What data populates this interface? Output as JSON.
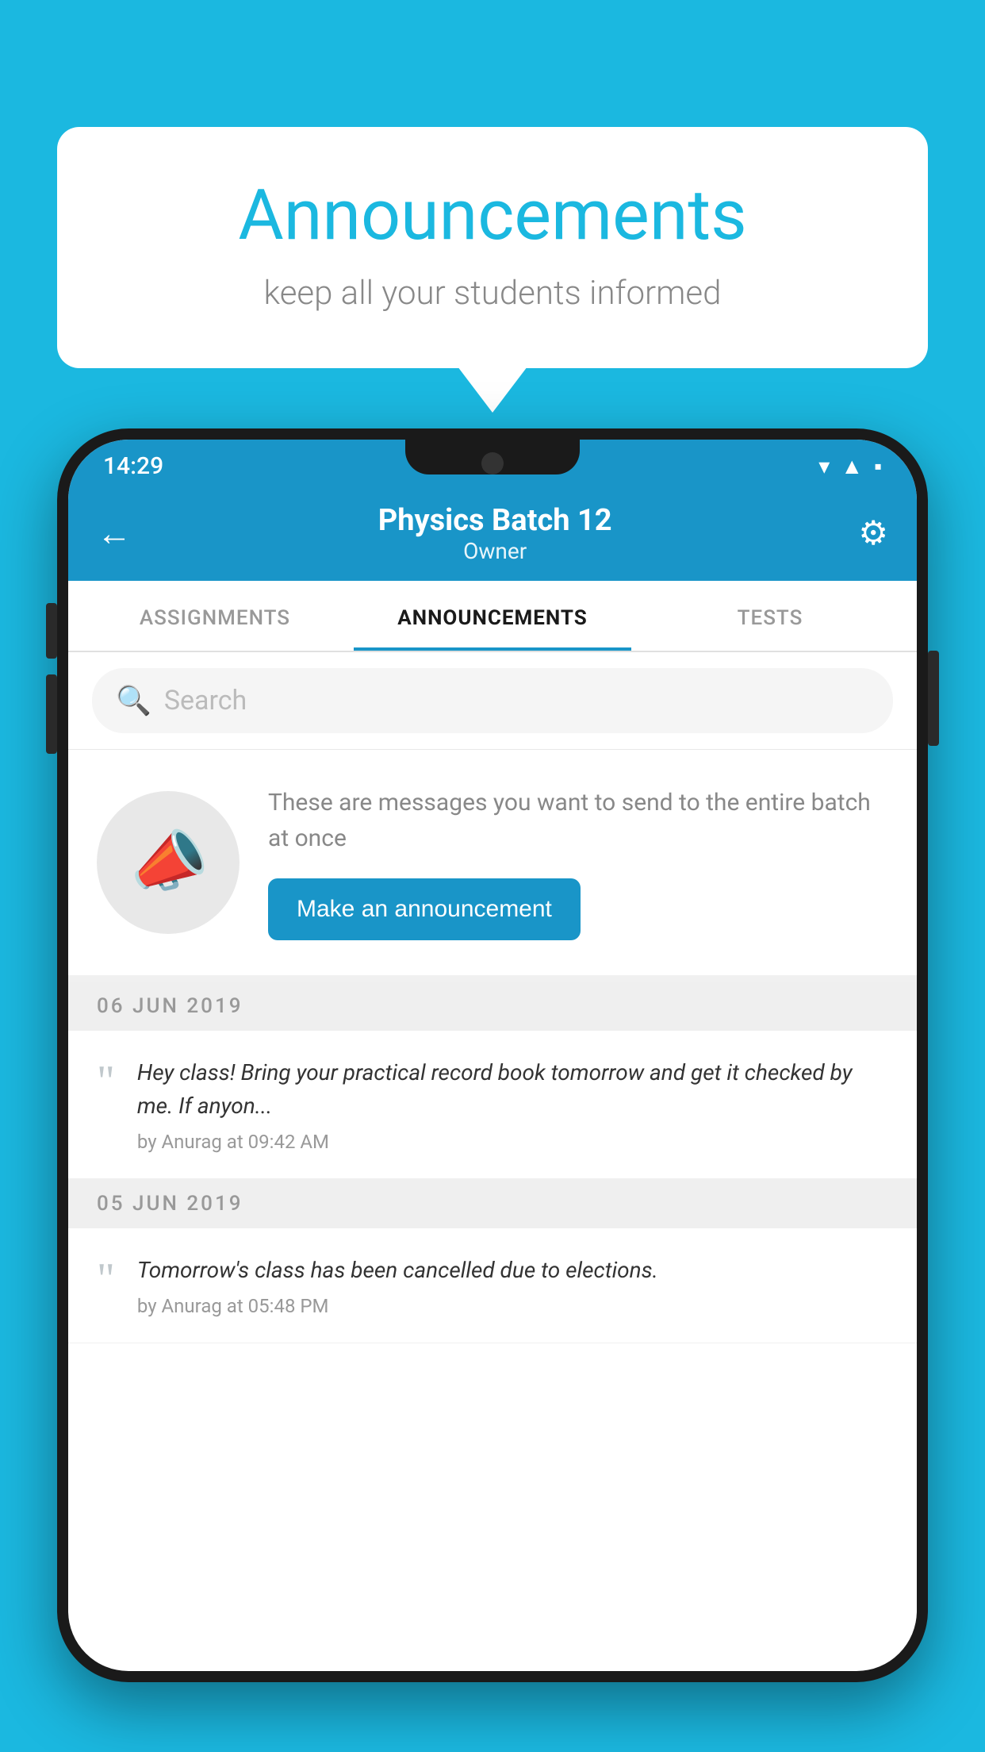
{
  "background": {
    "color": "#1bb8e0"
  },
  "speechBubble": {
    "title": "Announcements",
    "subtitle": "keep all your students informed"
  },
  "phone": {
    "statusBar": {
      "time": "14:29"
    },
    "header": {
      "title": "Physics Batch 12",
      "subtitle": "Owner",
      "backLabel": "←",
      "settingsLabel": "⚙"
    },
    "tabs": [
      {
        "label": "ASSIGNMENTS",
        "active": false
      },
      {
        "label": "ANNOUNCEMENTS",
        "active": true
      },
      {
        "label": "TESTS",
        "active": false
      }
    ],
    "search": {
      "placeholder": "Search"
    },
    "announcementIntro": {
      "description": "These are messages you want to send to the entire batch at once",
      "buttonLabel": "Make an announcement"
    },
    "announcements": [
      {
        "date": "06  JUN  2019",
        "text": "Hey class! Bring your practical record book tomorrow and get it checked by me. If anyon...",
        "meta": "by Anurag at 09:42 AM"
      },
      {
        "date": "05  JUN  2019",
        "text": "Tomorrow's class has been cancelled due to elections.",
        "meta": "by Anurag at 05:48 PM"
      }
    ]
  }
}
